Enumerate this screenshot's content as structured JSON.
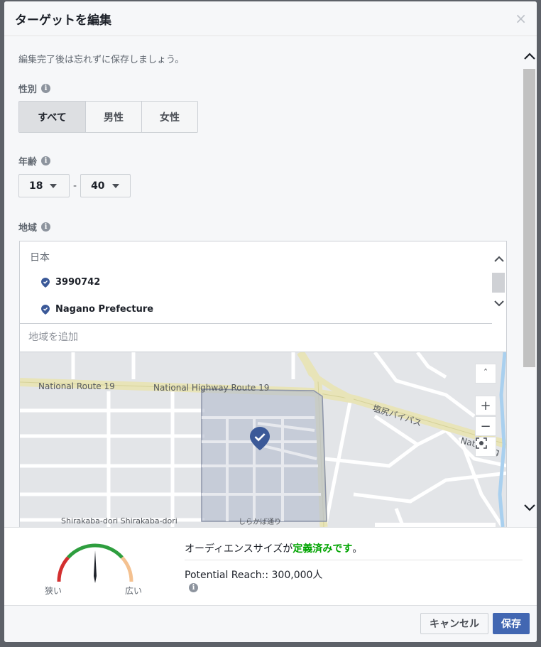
{
  "dialog": {
    "title": "ターゲットを編集",
    "close_symbol": "×"
  },
  "intro": "編集完了後は忘れずに保存しましょう。",
  "gender": {
    "label": "性別",
    "options": [
      "すべて",
      "男性",
      "女性"
    ],
    "selected": "すべて"
  },
  "age": {
    "label": "年齢",
    "min": "18",
    "max": "40",
    "separator": "-"
  },
  "region": {
    "label": "地域",
    "country": "日本",
    "items": [
      "3990742",
      "Nagano Prefecture"
    ],
    "add_placeholder": "地域を追加"
  },
  "map": {
    "labels": {
      "route19": "National Route 19",
      "highway19": "National Highway Route 19",
      "bypass": "塩尻バイパス",
      "national_cut": "Nat",
      "higher_cut": "Hig",
      "shirakaba": "Shirakaba-dori Shirakaba-dori",
      "shirakaba_jp": "しらかば通り"
    },
    "controls": {
      "up": "ˆ",
      "zoom_in": "+",
      "zoom_out": "−"
    }
  },
  "audience": {
    "prefix": "オーディエンスサイズが",
    "status": "定義済みです",
    "suffix": "。",
    "gauge_narrow": "狭い",
    "gauge_wide": "広い",
    "reach_text": "Potential Reach:: 300,000人"
  },
  "footer": {
    "cancel": "キャンセル",
    "save": "保存"
  },
  "colors": {
    "brand_blue": "#4267b2",
    "success_green": "#00a400",
    "pin_blue": "#3b5998"
  },
  "icons": {
    "info": "info-icon",
    "pin": "location-pin-icon",
    "check_pin": "check-pin-icon"
  }
}
